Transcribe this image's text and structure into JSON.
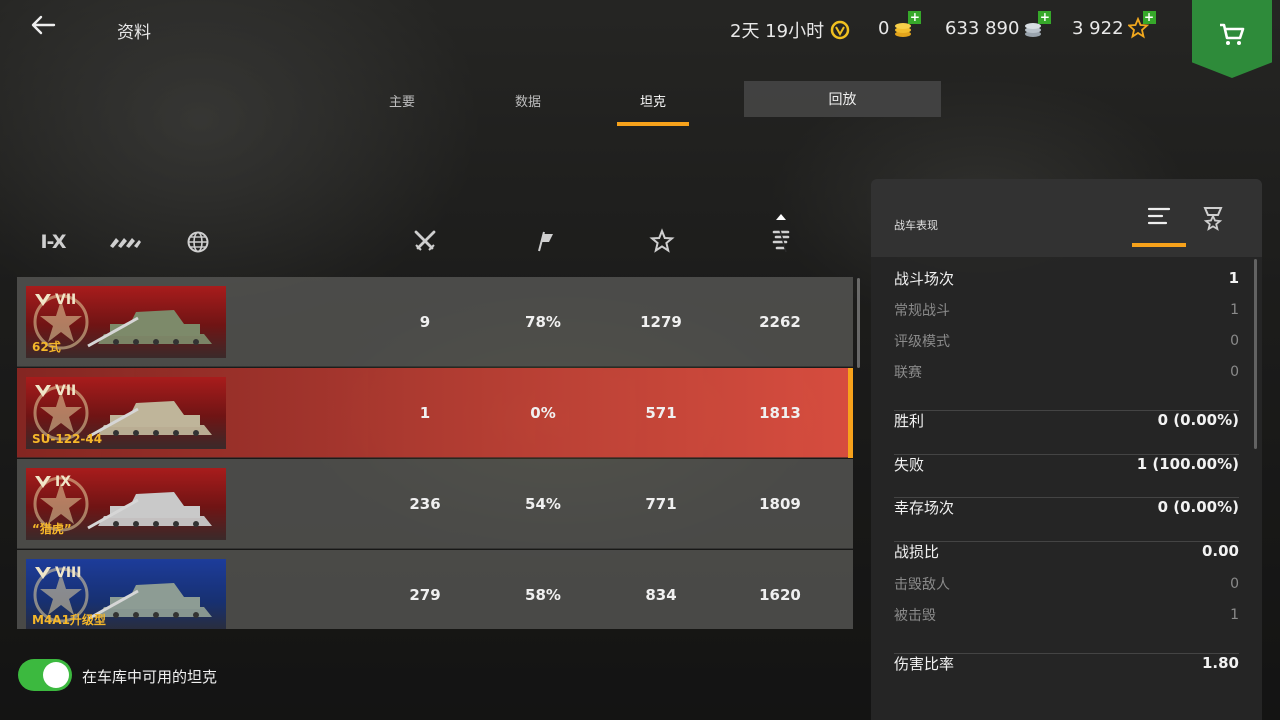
{
  "header": {
    "title": "资料",
    "timer": "2天 19小时",
    "gold": "0",
    "credits": "633 890",
    "free_xp": "3 922",
    "plus": "+"
  },
  "tabs": [
    {
      "label": "主要"
    },
    {
      "label": "数据"
    },
    {
      "label": "坦克"
    },
    {
      "label": "回放"
    }
  ],
  "filters": {
    "tier_label": "I-X"
  },
  "tanks": [
    {
      "tier": "VII",
      "name": "62式",
      "battles": "9",
      "winrate": "78%",
      "avg_xp": "1279",
      "avg_damage": "2262",
      "flag": "red"
    },
    {
      "tier": "VII",
      "name": "SU-122-44",
      "battles": "1",
      "winrate": "0%",
      "avg_xp": "571",
      "avg_damage": "1813",
      "flag": "red"
    },
    {
      "tier": "IX",
      "name": "“猎虎”",
      "battles": "236",
      "winrate": "54%",
      "avg_xp": "771",
      "avg_damage": "1809",
      "flag": "red"
    },
    {
      "tier": "VIII",
      "name": "M4A1升级型",
      "battles": "279",
      "winrate": "58%",
      "avg_xp": "834",
      "avg_damage": "1620",
      "flag": "blue"
    }
  ],
  "toggle": {
    "label": "在车库中可用的坦克",
    "on": true
  },
  "panel": {
    "title": "战车表现",
    "stats": [
      {
        "label": "战斗场次",
        "value": "1",
        "sub": false
      },
      {
        "label": "常规战斗",
        "value": "1",
        "sub": true
      },
      {
        "label": "评级模式",
        "value": "0",
        "sub": true
      },
      {
        "label": "联赛",
        "value": "0",
        "sub": true
      },
      {
        "label": "胜利",
        "value": "0 (0.00%)",
        "sub": false
      },
      {
        "label": "失败",
        "value": "1 (100.00%)",
        "sub": false
      },
      {
        "label": "幸存场次",
        "value": "0 (0.00%)",
        "sub": false
      },
      {
        "label": "战损比",
        "value": "0.00",
        "sub": false
      },
      {
        "label": "击毁敌人",
        "value": "0",
        "sub": true
      },
      {
        "label": "被击毁",
        "value": "1",
        "sub": true
      },
      {
        "label": "伤害比率",
        "value": "1.80",
        "sub": false
      }
    ]
  },
  "colors": {
    "accent": "#f7a21b",
    "green": "#3cb93f",
    "selected_row": "#d94a3e"
  }
}
